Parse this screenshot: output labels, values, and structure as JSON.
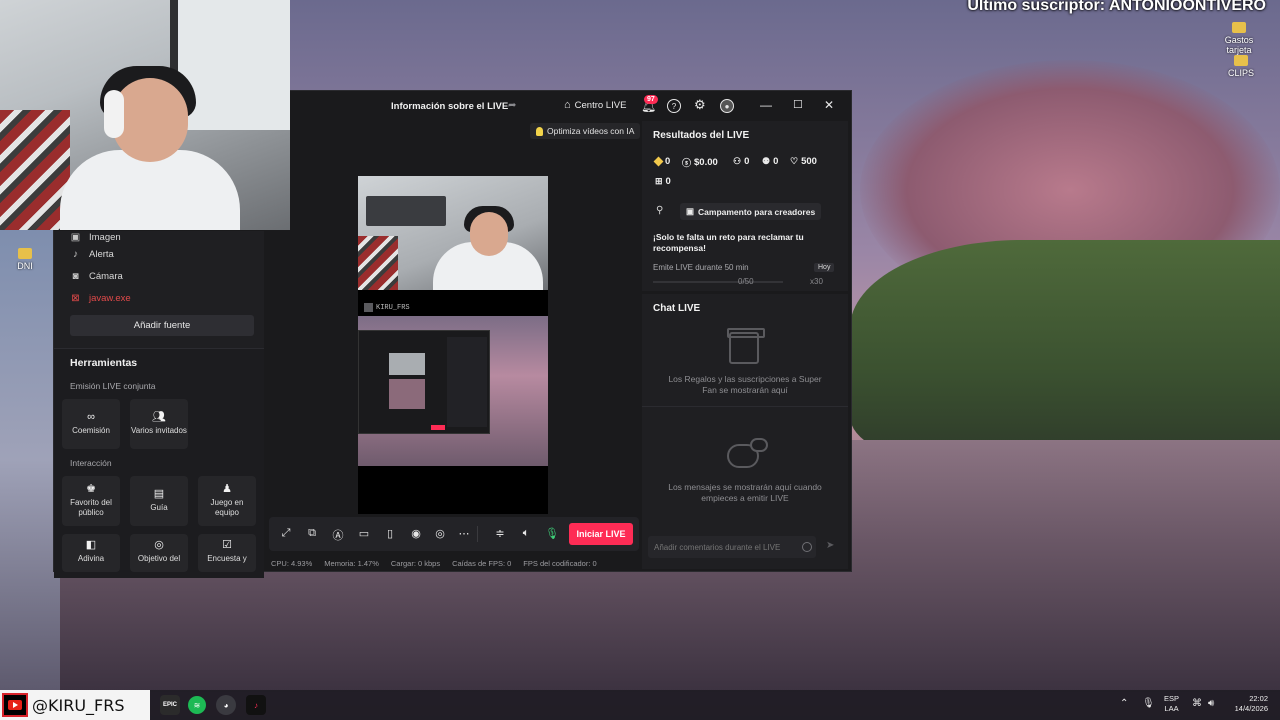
{
  "overlay": {
    "subscriber_text": "Último suscriptor: ANTONIOONTIVERO"
  },
  "desktop_icons": [
    {
      "label": "Gastos tarjeta",
      "icon": "folder-icon"
    },
    {
      "label": "CLIPS",
      "icon": "folder-icon"
    },
    {
      "label": "DNI",
      "icon": "folder-icon"
    }
  ],
  "studio": {
    "title": "Información sobre el LIVE",
    "centro_live": "Centro LIVE",
    "notifications_count": "97",
    "ai_button": "Optimiza vídeos con IA",
    "sources": [
      {
        "label": "Imagen",
        "icon": "image-icon"
      },
      {
        "label": "Alerta",
        "icon": "bell-icon"
      },
      {
        "label": "Cámara",
        "icon": "camera-icon"
      },
      {
        "label": "javaw.exe",
        "icon": "window-capture-icon",
        "status": "error"
      }
    ],
    "add_source": "Añadir fuente",
    "tools": {
      "title": "Herramientas",
      "section_joint": "Emisión LIVE conjunta",
      "joint_items": [
        {
          "label": "Coemisión",
          "icon": "link-icon"
        },
        {
          "label": "Varios invitados",
          "icon": "users-icon"
        }
      ],
      "section_interaction": "Interacción",
      "interaction_items": [
        {
          "label": "Favorito del público",
          "icon": "star-user-icon"
        },
        {
          "label": "Guía",
          "icon": "book-icon"
        },
        {
          "label": "Juego en equipo",
          "icon": "team-icon"
        },
        {
          "label": "Adivina",
          "icon": "cube-icon"
        },
        {
          "label": "Objetivo del",
          "icon": "target-icon"
        },
        {
          "label": "Encuesta y",
          "icon": "poll-icon"
        }
      ]
    },
    "preview": {
      "watermark": "KIRU_FRS"
    },
    "results": {
      "title": "Resultados del LIVE",
      "diamonds": "0",
      "earnings": "$0.00",
      "viewers": "0",
      "new_followers": "0",
      "likes": "500",
      "gifts": "0",
      "campaign_button": "Campamento para creadores",
      "challenge_text": "¡Solo te falta un reto para reclamar tu recompensa!",
      "challenge_task": "Emite LIVE durante 50 min",
      "challenge_when": "Hoy",
      "challenge_progress": "0/50",
      "challenge_progress_fraction": 0,
      "challenge_reward": "x30"
    },
    "chat": {
      "title": "Chat LIVE",
      "gifts_empty": "Los Regalos y las suscripciones a Super Fan se mostrarán aquí",
      "messages_empty": "Los mensajes se mostrarán aquí cuando empieces a emitir LIVE",
      "input_placeholder": "Añadir comentarios durante el LIVE"
    },
    "go_live": "Iniciar LIVE",
    "status": {
      "cpu": "CPU:  4.93%",
      "memory": "Memoria:  1.47%",
      "upload": "Cargar:  0 kbps",
      "fps_drops": "Caídas de FPS:  0",
      "encoder_fps": "FPS del codificador:  0"
    }
  },
  "taskbar": {
    "username": "@KIRU_FRS",
    "apps": [
      {
        "name": "epic-games",
        "label": "EPIC"
      },
      {
        "name": "spotify",
        "label": ""
      },
      {
        "name": "obs",
        "label": ""
      },
      {
        "name": "tiktok",
        "label": ""
      }
    ],
    "lang_line1": "ESP",
    "lang_line2": "LAA",
    "time": "22:02",
    "date": "14/4/2026"
  },
  "colors": {
    "accent": "#fe2c55",
    "window_bg": "#1a1a1c",
    "panel_bg": "#1f1f22"
  }
}
